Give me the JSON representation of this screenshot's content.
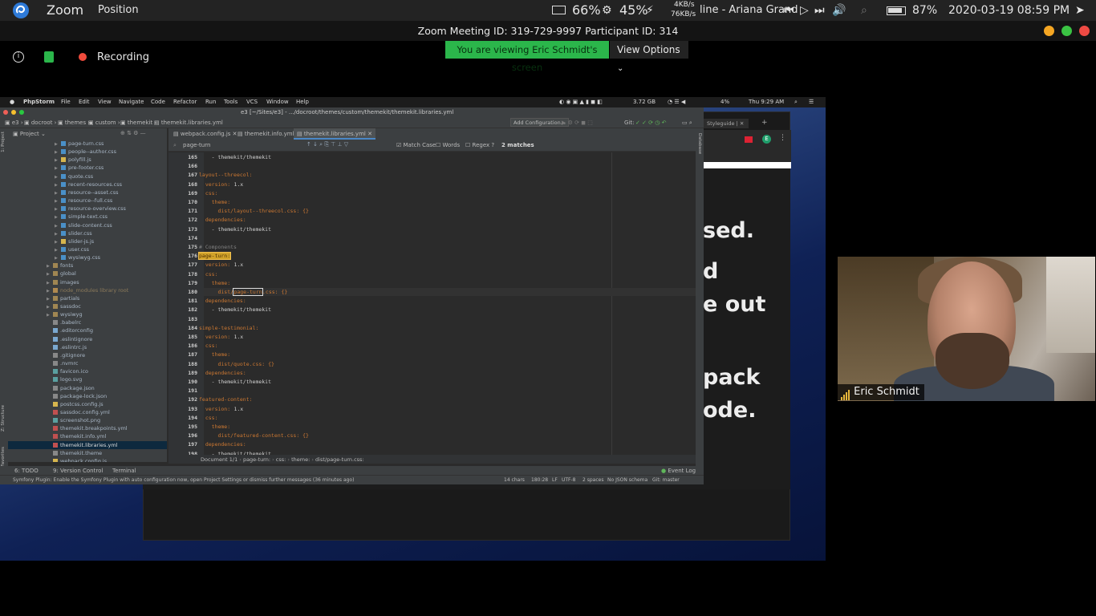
{
  "top_bar": {
    "app": "Zoom",
    "menu": "Position",
    "battery1": "66%",
    "cpu": "45%",
    "net_up": "4KB/s",
    "net_down": "76KB/s",
    "track": "line - Ariana Grand",
    "battery2": "87%",
    "datetime": "2020-03-19 08:59 PM"
  },
  "zoom": {
    "meeting_title": "Zoom Meeting ID: 319-729-9997 Participant ID: 314",
    "recording": "Recording",
    "viewing": "You are viewing Eric Schmidt's screen",
    "view_options": "View Options"
  },
  "mac": {
    "app": "PhpStorm",
    "menus": [
      "File",
      "Edit",
      "View",
      "Navigate",
      "Code",
      "Refactor",
      "Run",
      "Tools",
      "VCS",
      "Window",
      "Help"
    ],
    "memory": "3.72 GB",
    "battery": "4%",
    "clock": "Thu 9:29 AM"
  },
  "ide": {
    "window_title": "e3 [~/Sites/e3] - .../docroot/themes/custom/themekit/themekit.libraries.yml",
    "breadcrumbs": [
      "e3",
      "docroot",
      "themes",
      "custom",
      "themekit",
      "themekit.libraries.yml"
    ],
    "add_config": "Add Configuration...",
    "git": "Git:",
    "tabs": [
      "webpack.config.js",
      "themekit.info.yml",
      "themekit.libraries.yml"
    ],
    "search": {
      "query": "page-turn",
      "match_case": "Match Case",
      "words": "Words",
      "regex": "Regex",
      "matches": "2 matches"
    },
    "project_label": "Project",
    "tree": [
      {
        "t": "page-turn.css",
        "k": "css",
        "i": 1
      },
      {
        "t": "people--author.css",
        "k": "css",
        "i": 1
      },
      {
        "t": "polyfill.js",
        "k": "js",
        "i": 1
      },
      {
        "t": "pre-footer.css",
        "k": "css",
        "i": 1
      },
      {
        "t": "quote.css",
        "k": "css",
        "i": 1
      },
      {
        "t": "recent-resources.css",
        "k": "css",
        "i": 1
      },
      {
        "t": "resource--asset.css",
        "k": "css",
        "i": 1
      },
      {
        "t": "resource--full.css",
        "k": "css",
        "i": 1
      },
      {
        "t": "resource-overview.css",
        "k": "css",
        "i": 1
      },
      {
        "t": "simple-text.css",
        "k": "css",
        "i": 1
      },
      {
        "t": "slide-content.css",
        "k": "css",
        "i": 1
      },
      {
        "t": "slider.css",
        "k": "css",
        "i": 1
      },
      {
        "t": "slider-js.js",
        "k": "js",
        "i": 1
      },
      {
        "t": "user.css",
        "k": "css",
        "i": 1
      },
      {
        "t": "wysiwyg.css",
        "k": "css",
        "i": 1
      },
      {
        "t": "fonts",
        "k": "dir",
        "i": 0
      },
      {
        "t": "global",
        "k": "dir",
        "i": 0
      },
      {
        "t": "images",
        "k": "dir",
        "i": 0
      },
      {
        "t": "node_modules  library root",
        "k": "lib",
        "i": 0
      },
      {
        "t": "partials",
        "k": "dir",
        "i": 0
      },
      {
        "t": "sassdoc",
        "k": "dir",
        "i": 0
      },
      {
        "t": "wysiwyg",
        "k": "dir",
        "i": 0
      },
      {
        "t": ".babelrc",
        "k": "file",
        "i": 0
      },
      {
        "t": ".editorconfig",
        "k": "cfg",
        "i": 0
      },
      {
        "t": ".eslintignore",
        "k": "cfg",
        "i": 0
      },
      {
        "t": ".eslintrc.js",
        "k": "cfg",
        "i": 0
      },
      {
        "t": ".gitignore",
        "k": "file",
        "i": 0
      },
      {
        "t": ".nvmrc",
        "k": "file",
        "i": 0
      },
      {
        "t": "favicon.ico",
        "k": "img",
        "i": 0
      },
      {
        "t": "logo.svg",
        "k": "img",
        "i": 0
      },
      {
        "t": "package.json",
        "k": "file",
        "i": 0
      },
      {
        "t": "package-lock.json",
        "k": "file",
        "i": 0
      },
      {
        "t": "postcss.config.js",
        "k": "js",
        "i": 0
      },
      {
        "t": "sassdoc.config.yml",
        "k": "yml",
        "i": 0
      },
      {
        "t": "screenshot.png",
        "k": "img",
        "i": 0
      },
      {
        "t": "themekit.breakpoints.yml",
        "k": "yml",
        "i": 0
      },
      {
        "t": "themekit.info.yml",
        "k": "yml",
        "i": 0
      },
      {
        "t": "themekit.libraries.yml",
        "k": "yml",
        "i": 0,
        "sel": true
      },
      {
        "t": "themekit.theme",
        "k": "file",
        "i": 0
      },
      {
        "t": "webpack.config.js",
        "k": "js",
        "i": 0
      }
    ],
    "code": [
      {
        "n": "165",
        "s": [
          [
            "    - themekit/themekit",
            "w"
          ]
        ]
      },
      {
        "n": "166",
        "s": []
      },
      {
        "n": "167",
        "s": [
          [
            "layout--threecol:",
            "k"
          ]
        ]
      },
      {
        "n": "168",
        "s": [
          [
            "  version: ",
            "k"
          ],
          [
            "1.x",
            "w"
          ]
        ]
      },
      {
        "n": "169",
        "s": [
          [
            "  css:",
            "k"
          ]
        ]
      },
      {
        "n": "170",
        "s": [
          [
            "    theme:",
            "k"
          ]
        ]
      },
      {
        "n": "171",
        "s": [
          [
            "      dist/layout--threecol.css: {}",
            "k"
          ]
        ]
      },
      {
        "n": "172",
        "s": [
          [
            "  dependencies:",
            "k"
          ]
        ]
      },
      {
        "n": "173",
        "s": [
          [
            "    - themekit/themekit",
            "w"
          ]
        ]
      },
      {
        "n": "174",
        "s": []
      },
      {
        "n": "175",
        "s": [
          [
            "# Components",
            "c"
          ]
        ]
      },
      {
        "n": "176",
        "s": [
          [
            "page-turn:",
            "h"
          ]
        ]
      },
      {
        "n": "177",
        "s": [
          [
            "  version: ",
            "k"
          ],
          [
            "1.x",
            "w"
          ]
        ]
      },
      {
        "n": "178",
        "s": [
          [
            "  css:",
            "k"
          ]
        ]
      },
      {
        "n": "179",
        "s": [
          [
            "    theme:",
            "k"
          ]
        ]
      },
      {
        "n": "180",
        "s": [
          [
            "      dist/",
            "k"
          ],
          [
            "page-turn",
            "m"
          ],
          [
            ".css: {}",
            "k"
          ]
        ],
        "cur": true
      },
      {
        "n": "181",
        "s": [
          [
            "  dependencies:",
            "k"
          ]
        ]
      },
      {
        "n": "182",
        "s": [
          [
            "    - themekit/themekit",
            "w"
          ]
        ]
      },
      {
        "n": "183",
        "s": []
      },
      {
        "n": "184",
        "s": [
          [
            "simple-testimonial:",
            "k"
          ]
        ]
      },
      {
        "n": "185",
        "s": [
          [
            "  version: ",
            "k"
          ],
          [
            "1.x",
            "w"
          ]
        ]
      },
      {
        "n": "186",
        "s": [
          [
            "  css:",
            "k"
          ]
        ]
      },
      {
        "n": "187",
        "s": [
          [
            "    theme:",
            "k"
          ]
        ]
      },
      {
        "n": "188",
        "s": [
          [
            "      dist/quote.css: {}",
            "k"
          ]
        ]
      },
      {
        "n": "189",
        "s": [
          [
            "  dependencies:",
            "k"
          ]
        ]
      },
      {
        "n": "190",
        "s": [
          [
            "    - themekit/themekit",
            "w"
          ]
        ]
      },
      {
        "n": "191",
        "s": []
      },
      {
        "n": "192",
        "s": [
          [
            "featured-content:",
            "k"
          ]
        ]
      },
      {
        "n": "193",
        "s": [
          [
            "  version: ",
            "k"
          ],
          [
            "1.x",
            "w"
          ]
        ]
      },
      {
        "n": "194",
        "s": [
          [
            "  css:",
            "k"
          ]
        ]
      },
      {
        "n": "195",
        "s": [
          [
            "    theme:",
            "k"
          ]
        ]
      },
      {
        "n": "196",
        "s": [
          [
            "      dist/featured-content.css: {}",
            "k"
          ]
        ]
      },
      {
        "n": "197",
        "s": [
          [
            "  dependencies:",
            "k"
          ]
        ]
      },
      {
        "n": "198",
        "s": [
          [
            "    - themekit/themekit",
            "w"
          ]
        ]
      }
    ],
    "code_breadcrumb": [
      "Document 1/1",
      "page-turn:",
      "css:",
      "theme:",
      "dist/page-turn.css:"
    ],
    "bottom_tabs": [
      "6: TODO",
      "9: Version Control",
      "Terminal"
    ],
    "event_log": "Event Log",
    "status_message": "Symfony Plugin: Enable the Symfony Plugin with auto configuration now, open Project Settings or dismiss further messages (36 minutes ago)",
    "status_right": [
      "14 chars",
      "180:28",
      "LF",
      "UTF-8",
      "2 spaces",
      "No JSON schema",
      "Git: master"
    ],
    "side_left": [
      "1: Project",
      "Z: Structure",
      "2: Favorites"
    ],
    "side_right": "Database"
  },
  "browser": {
    "tab": "Styleguide |",
    "slide_lines": [
      "sed.",
      "d",
      "e out",
      "pack",
      "ode."
    ]
  },
  "participant": {
    "name": "Eric Schmidt"
  },
  "colors": {
    "zoom_green": "#2bb64b",
    "yml_key": "#cc7832",
    "yml_value": "#a9b7c6"
  }
}
